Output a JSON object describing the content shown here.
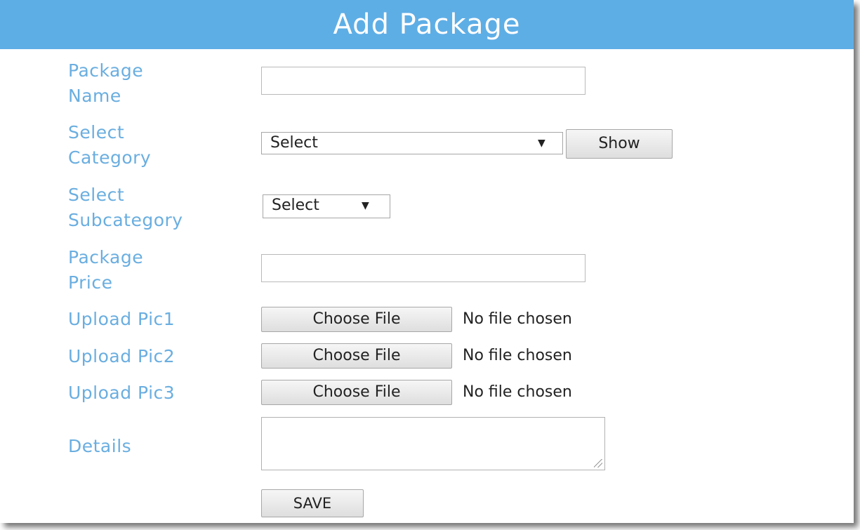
{
  "header": {
    "title": "Add Package"
  },
  "form": {
    "package_name": {
      "label_line1": "Package",
      "label_line2": "Name",
      "value": ""
    },
    "category": {
      "label_line1": "Select",
      "label_line2": "Category",
      "selected": "Select",
      "show_label": "Show"
    },
    "subcategory": {
      "label_line1": "Select",
      "label_line2": "Subcategory",
      "selected": "Select"
    },
    "package_price": {
      "label_line1": "Package",
      "label_line2": "Price",
      "value": ""
    },
    "pic1": {
      "label": "Upload Pic1",
      "button": "Choose File",
      "status": "No file chosen"
    },
    "pic2": {
      "label": "Upload Pic2",
      "button": "Choose File",
      "status": "No file chosen"
    },
    "pic3": {
      "label": "Upload Pic3",
      "button": "Choose File",
      "status": "No file chosen"
    },
    "details": {
      "label": "Details",
      "value": ""
    },
    "save_label": "SAVE"
  },
  "icons": {
    "dropdown_arrow": "chevron-down-icon",
    "resize_grip": "resize-grip-icon"
  },
  "colors": {
    "header_bg": "#5eaee6",
    "label_text": "#6aaee0"
  }
}
